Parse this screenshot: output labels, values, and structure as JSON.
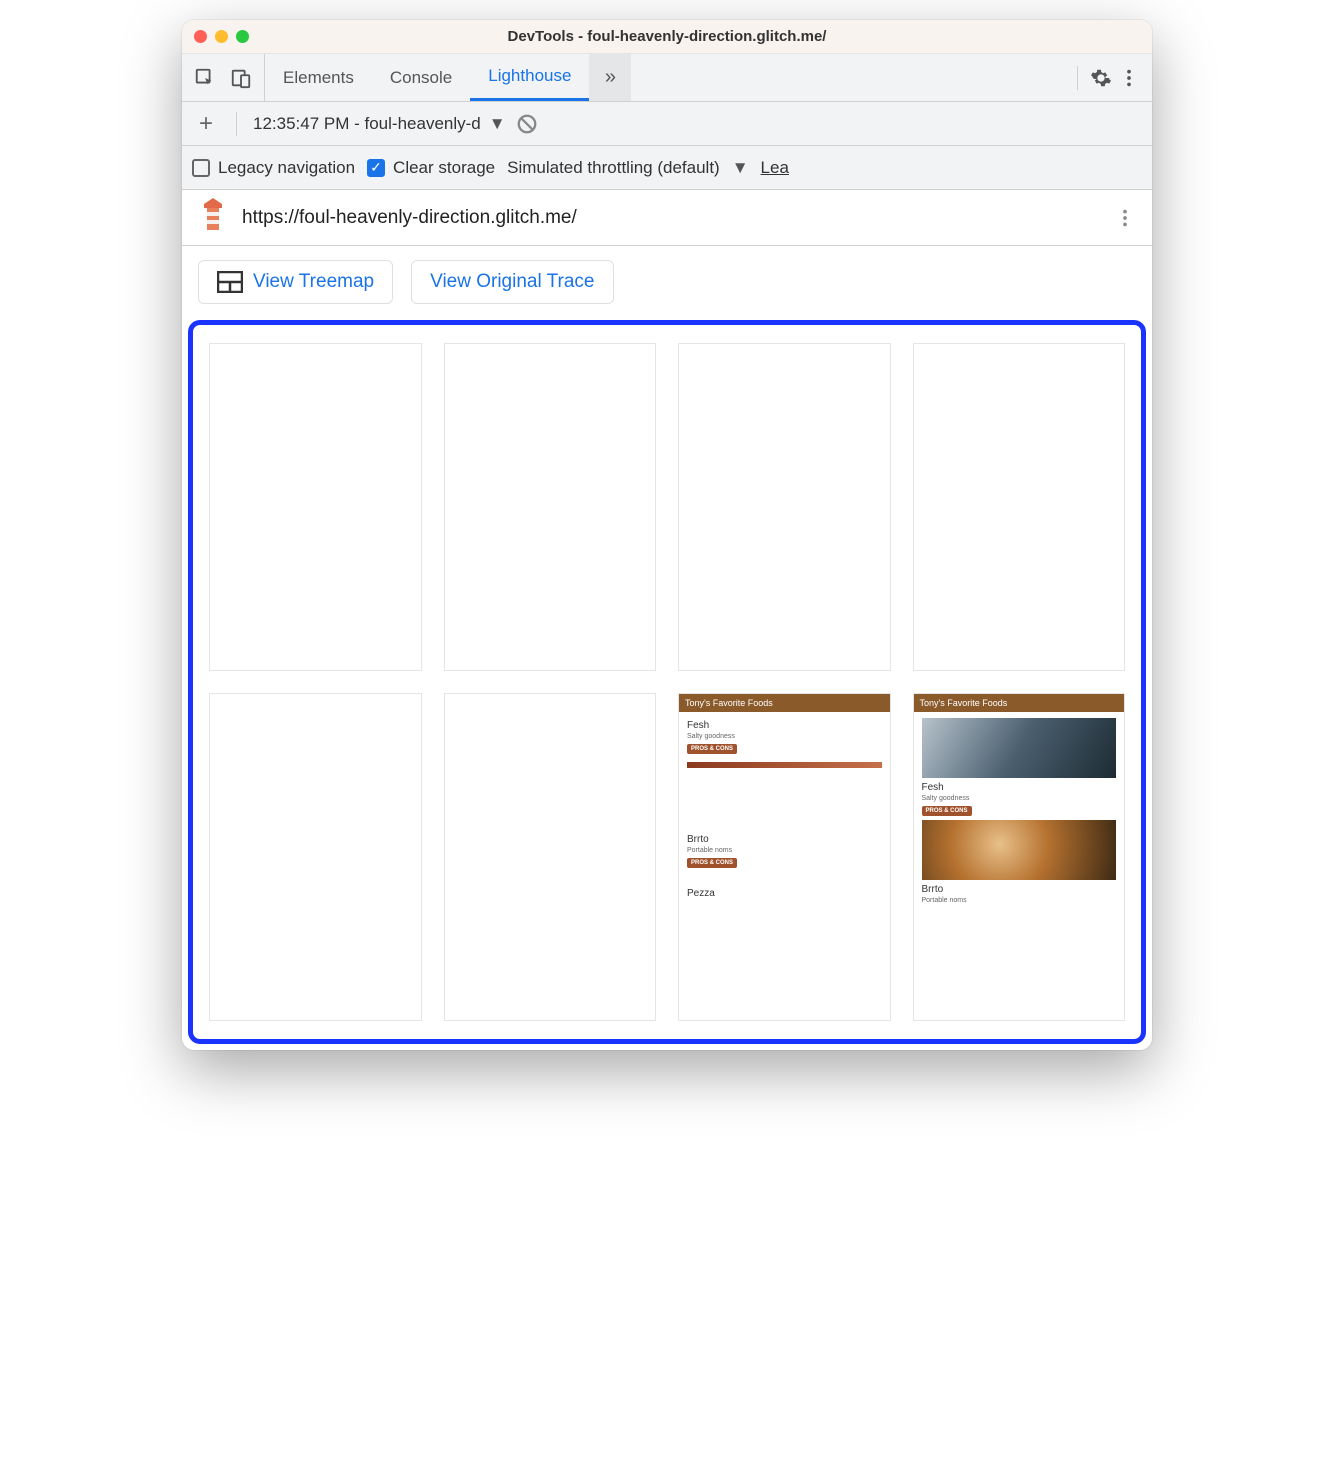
{
  "window": {
    "title": "DevTools - foul-heavenly-direction.glitch.me/"
  },
  "tabs": {
    "elements": "Elements",
    "console": "Console",
    "lighthouse": "Lighthouse",
    "overflow_glyph": "»"
  },
  "auditbar": {
    "plus": "+",
    "selected_report": "12:35:47 PM - foul-heavenly-d"
  },
  "options": {
    "legacy_label": "Legacy navigation",
    "clear_label": "Clear storage",
    "throttle_label": "Simulated throttling (default)",
    "learn_label": "Lea"
  },
  "url": {
    "value": "https://foul-heavenly-direction.glitch.me/"
  },
  "buttons": {
    "treemap": "View Treemap",
    "trace": "View Original Trace"
  },
  "filmstrip": {
    "mini_header": "Tony's Favorite Foods",
    "item1_title": "Fesh",
    "item1_sub": "Salty goodness",
    "item2_title": "Brrto",
    "item2_sub": "Portable noms",
    "item3_title": "Pezza",
    "btn_label": "PROS & CONS"
  }
}
